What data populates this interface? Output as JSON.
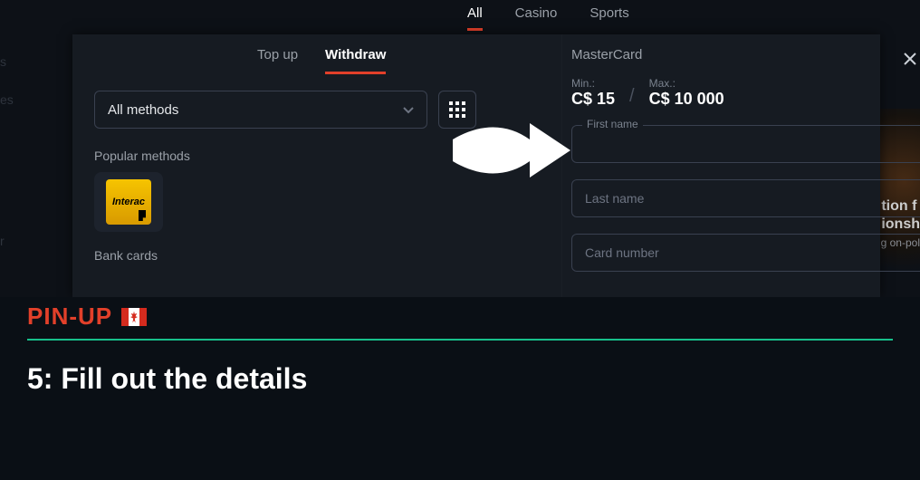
{
  "topnav": {
    "all": "All",
    "casino": "Casino",
    "sports": "Sports",
    "active": "all"
  },
  "withdraw_tabs": {
    "topup": "Top up",
    "withdraw": "Withdraw",
    "active": "withdraw"
  },
  "method_select": {
    "label": "All methods"
  },
  "sections": {
    "popular": "Popular methods",
    "bank": "Bank cards"
  },
  "payment_tiles": {
    "interac": "Interac"
  },
  "form": {
    "title": "MasterCard",
    "min_label": "Min.:",
    "min_value": "C$ 15",
    "max_label": "Max.:",
    "max_value": "C$ 10 000",
    "first_name_label": "First name",
    "last_name_ph": "Last name",
    "card_number_ph": "Card number"
  },
  "brand": {
    "logo": "PIN-UP"
  },
  "step": {
    "caption": "5: Fill out the details"
  },
  "bg": {
    "right_line1": "tion f",
    "right_line2": "ionsh",
    "right_sub": "have g\non-pol"
  },
  "footer": {
    "opts": ""
  },
  "bg_left": {
    "a": "s",
    "b": "es",
    "c": "r"
  }
}
